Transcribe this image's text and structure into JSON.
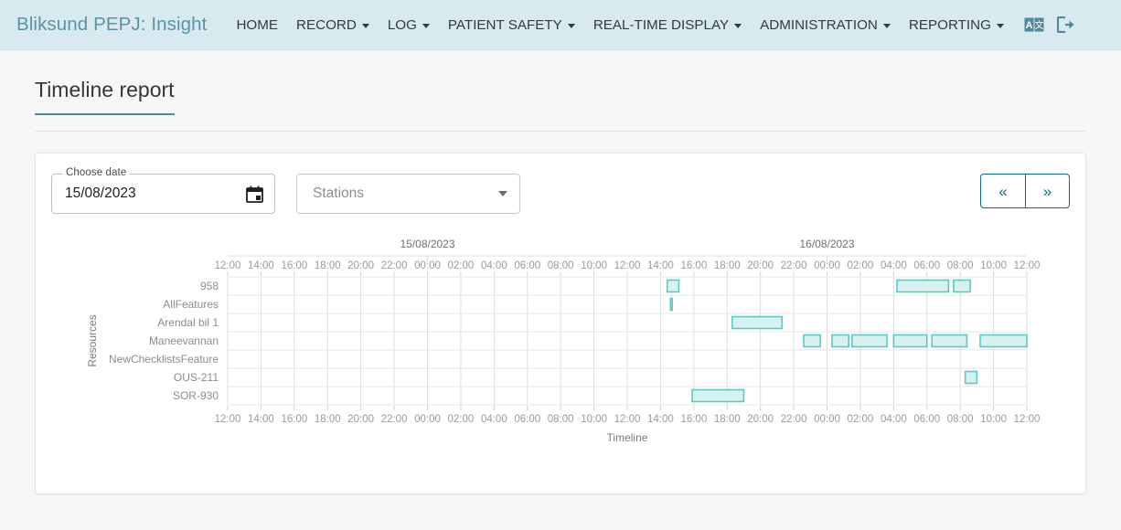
{
  "navbar": {
    "brand": "Bliksund PEPJ: Insight",
    "items": [
      {
        "label": "HOME",
        "has_caret": false
      },
      {
        "label": "RECORD",
        "has_caret": true
      },
      {
        "label": "LOG",
        "has_caret": true
      },
      {
        "label": "PATIENT SAFETY",
        "has_caret": true
      },
      {
        "label": "REAL-TIME DISPLAY",
        "has_caret": true
      },
      {
        "label": "ADMINISTRATION",
        "has_caret": true
      },
      {
        "label": "REPORTING",
        "has_caret": true
      }
    ],
    "icons": [
      {
        "name": "translate-icon"
      },
      {
        "name": "logout-icon"
      }
    ],
    "background": "#d8eaef",
    "brand_color": "#5a93a6"
  },
  "page": {
    "title": "Timeline report",
    "title_underline_color": "#4d8b9c"
  },
  "controls": {
    "date_label": "Choose date",
    "date_value": "15/08/2023",
    "calendar_icon": "calendar-icon",
    "stations_placeholder": "Stations",
    "prev_button": "«",
    "next_button": "»",
    "accent": "#0e6e8c"
  },
  "chart_data": {
    "type": "timeline",
    "title": "",
    "xlabel": "Timeline",
    "ylabel": "Resources",
    "day_headers": [
      {
        "label": "15/08/2023",
        "center_hour": 12
      },
      {
        "label": "16/08/2023",
        "center_hour": 36
      }
    ],
    "x_start_label": "12:00",
    "hours_total": 48,
    "tick_step_hours": 2,
    "tick_labels": [
      "12:00",
      "14:00",
      "16:00",
      "18:00",
      "20:00",
      "22:00",
      "00:00",
      "02:00",
      "04:00",
      "06:00",
      "08:00",
      "10:00",
      "12:00",
      "14:00",
      "16:00",
      "18:00",
      "20:00",
      "22:00",
      "00:00",
      "02:00",
      "04:00",
      "06:00",
      "08:00",
      "10:00",
      "12:00"
    ],
    "grid": true,
    "bar_fill": "#d7f0f0",
    "bar_stroke": "#5cc8c8",
    "categories": [
      "958",
      "AllFeatures",
      "Arendal bil 1",
      "Maneevannan",
      "NewChecklistsFeature",
      "OUS-211",
      "SOR-930"
    ],
    "series": [
      {
        "name": "958",
        "row": 0,
        "bars": [
          {
            "start_hour": 26.4,
            "end_hour": 27.1
          },
          {
            "start_hour": 40.2,
            "end_hour": 43.3
          },
          {
            "start_hour": 43.6,
            "end_hour": 44.6
          }
        ]
      },
      {
        "name": "AllFeatures",
        "row": 1,
        "bars": [
          {
            "start_hour": 26.6,
            "end_hour": 26.7
          }
        ]
      },
      {
        "name": "Arendal bil 1",
        "row": 2,
        "bars": [
          {
            "start_hour": 30.3,
            "end_hour": 33.3
          }
        ]
      },
      {
        "name": "Maneevannan",
        "row": 3,
        "bars": [
          {
            "start_hour": 34.6,
            "end_hour": 35.6
          },
          {
            "start_hour": 36.3,
            "end_hour": 37.3
          },
          {
            "start_hour": 37.5,
            "end_hour": 39.6
          },
          {
            "start_hour": 40.0,
            "end_hour": 42.0
          },
          {
            "start_hour": 42.3,
            "end_hour": 44.4
          },
          {
            "start_hour": 45.2,
            "end_hour": 48.0
          }
        ]
      },
      {
        "name": "NewChecklistsFeature",
        "row": 4,
        "bars": []
      },
      {
        "name": "OUS-211",
        "row": 5,
        "bars": [
          {
            "start_hour": 44.3,
            "end_hour": 45.0
          }
        ]
      },
      {
        "name": "SOR-930",
        "row": 6,
        "bars": [
          {
            "start_hour": 27.9,
            "end_hour": 31.0
          }
        ]
      }
    ]
  }
}
